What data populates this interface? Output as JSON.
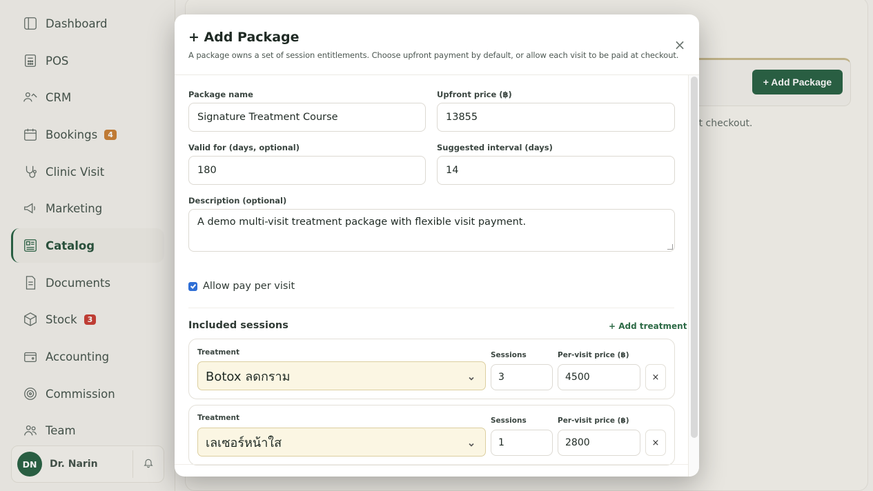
{
  "sidebar": {
    "items": [
      {
        "label": "Dashboard",
        "icon": "dashboard-icon"
      },
      {
        "label": "POS",
        "icon": "pos-icon"
      },
      {
        "label": "CRM",
        "icon": "crm-icon"
      },
      {
        "label": "Bookings",
        "icon": "calendar-icon",
        "badge": "4"
      },
      {
        "label": "Clinic Visit",
        "icon": "stethoscope-icon"
      },
      {
        "label": "Marketing",
        "icon": "megaphone-icon"
      },
      {
        "label": "Catalog",
        "icon": "catalog-icon",
        "active": true
      },
      {
        "label": "Documents",
        "icon": "document-icon"
      },
      {
        "label": "Stock",
        "icon": "box-icon",
        "badge": "3"
      },
      {
        "label": "Accounting",
        "icon": "wallet-icon"
      },
      {
        "label": "Commission",
        "icon": "target-icon"
      },
      {
        "label": "Team",
        "icon": "team-icon"
      }
    ],
    "user": {
      "initials": "DN",
      "name": "Dr. Narin"
    }
  },
  "background": {
    "add_package_label": "+ Add Package",
    "text_fragment": "at checkout."
  },
  "modal": {
    "title": "+ Add Package",
    "subtitle": "A package owns a set of session entitlements. Choose upfront payment by default, or allow each visit to be paid at checkout.",
    "close_label": "×",
    "fields": {
      "package_name": {
        "label": "Package name",
        "value": "Signature Treatment Course"
      },
      "upfront_price": {
        "label": "Upfront price (฿)",
        "value": "13855"
      },
      "valid_for": {
        "label": "Valid for (days, optional)",
        "value": "180"
      },
      "suggested_interval": {
        "label": "Suggested interval (days)",
        "value": "14"
      },
      "description": {
        "label": "Description (optional)",
        "value": "A demo multi-visit treatment package with flexible visit payment."
      }
    },
    "allow_pay_per_visit": {
      "label": "Allow pay per visit",
      "checked": true
    },
    "included_sessions": {
      "title": "Included sessions",
      "add_label": "+ Add treatment",
      "col_treatment": "Treatment",
      "col_sessions": "Sessions",
      "col_price": "Per-visit price (฿)",
      "remove_label": "×",
      "rows": [
        {
          "treatment": "Botox ลดกราม",
          "sessions": "3",
          "price": "4500"
        },
        {
          "treatment": "เลเซอร์หน้าใส",
          "sessions": "1",
          "price": "2800"
        }
      ]
    }
  },
  "colors": {
    "primary": "#1e5a3c",
    "accent_badge": "#c97a2c",
    "badge_red": "#c8352c",
    "checkbox": "#2f6fd6"
  }
}
